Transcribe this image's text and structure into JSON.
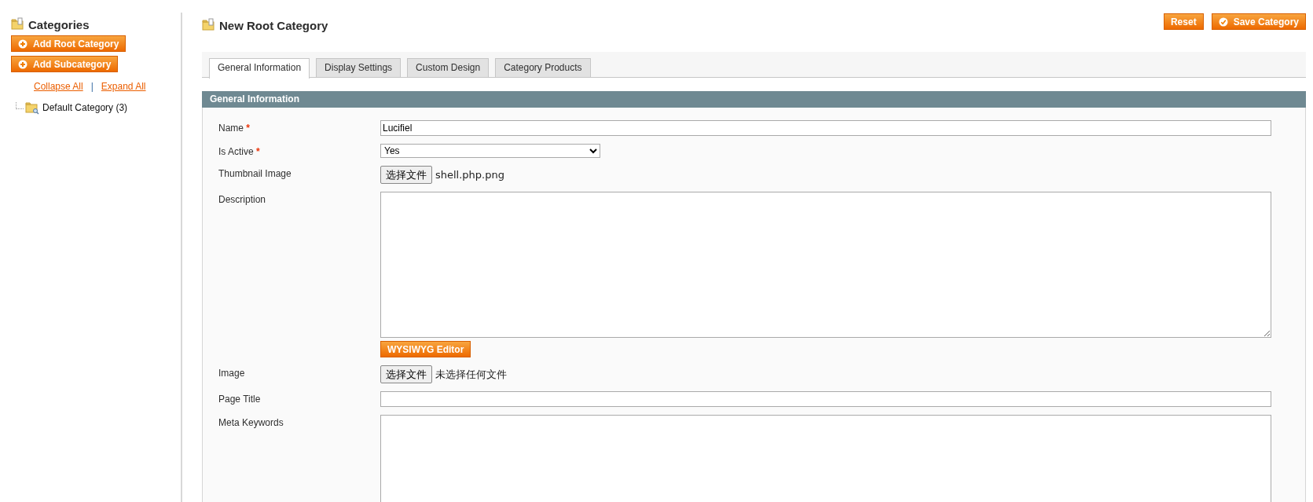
{
  "sidebar": {
    "title": "Categories",
    "buttons": [
      {
        "label": "Add Root Category",
        "kind": "add"
      },
      {
        "label": "Add Subcategory",
        "kind": "add"
      }
    ],
    "links": [
      "Collapse All",
      "Expand All"
    ],
    "link_separator": "|",
    "tree": [
      {
        "label": "Default Category (3)"
      }
    ]
  },
  "header": {
    "title": "New Root Category",
    "buttons": [
      {
        "label": "Reset",
        "kind": "plain"
      },
      {
        "label": "Save Category",
        "kind": "check"
      }
    ]
  },
  "tabs": [
    {
      "label": "General Information",
      "selected": true
    },
    {
      "label": "Display Settings",
      "selected": false
    },
    {
      "label": "Custom Design",
      "selected": false
    },
    {
      "label": "Category Products",
      "selected": false
    }
  ],
  "section": {
    "title": "General Information",
    "fields": [
      {
        "kind": "text",
        "label": "Name",
        "required_mark": "*",
        "value": "Lucifiel"
      },
      {
        "kind": "select",
        "label": "Is Active",
        "required_mark": "*",
        "value": "Yes"
      },
      {
        "kind": "file",
        "label": "Thumbnail Image",
        "button": "选择文件",
        "file_status": "shell.php.png"
      },
      {
        "kind": "textarea",
        "label": "Description",
        "editor_button": "WYSIWYG Editor"
      },
      {
        "kind": "file",
        "label": "Image",
        "button": "选择文件",
        "file_status": "未选择任何文件"
      },
      {
        "kind": "text",
        "label": "Page Title"
      },
      {
        "kind": "textarea",
        "label": "Meta Keywords"
      }
    ]
  }
}
